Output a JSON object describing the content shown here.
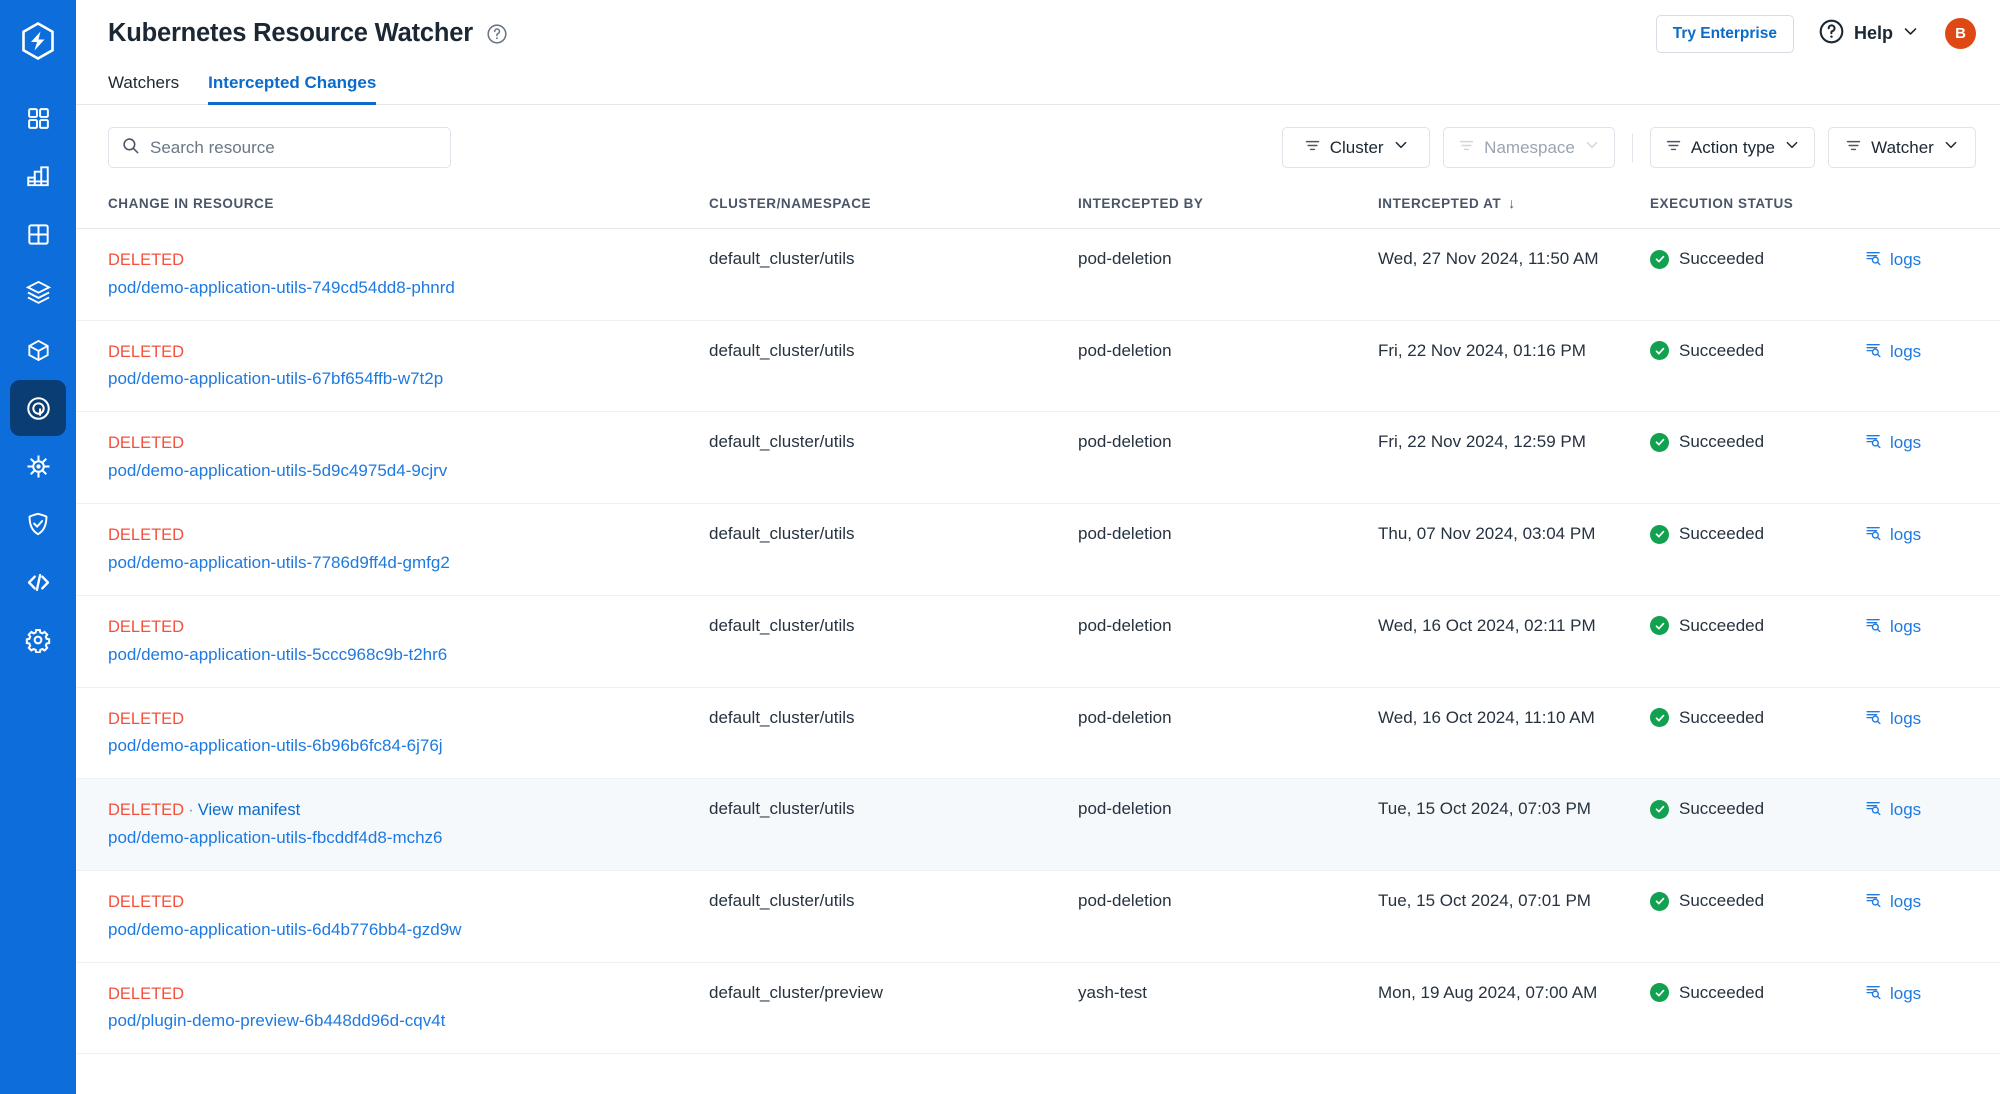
{
  "brand": {
    "accent": "#0d6ddb",
    "sidebar_bg": "#0d6ddb",
    "active_item_bg": "#0a3d73",
    "link": "#1e7ae0",
    "danger": "#f4503c",
    "success": "#12a150",
    "avatar_bg": "#dd4814"
  },
  "header": {
    "title": "Kubernetes Resource Watcher",
    "help_tooltip_icon": "question-circle-icon",
    "try_enterprise_label": "Try Enterprise",
    "help_label": "Help",
    "help_chevron_icon": "chevron-down-icon",
    "avatar_initial": "B"
  },
  "sidebar": {
    "logo_icon": "harness-logo-icon",
    "items": [
      {
        "icon": "dashboard-grid-icon",
        "name": "dashboards",
        "active": false
      },
      {
        "icon": "bar-chart-icon",
        "name": "analytics",
        "active": false
      },
      {
        "icon": "table-grid-icon",
        "name": "projects",
        "active": false
      },
      {
        "icon": "layers-box-icon",
        "name": "deployments",
        "active": false
      },
      {
        "icon": "cube-icon",
        "name": "artifacts",
        "active": false
      },
      {
        "icon": "target-circle-icon",
        "name": "chaos",
        "active": true
      },
      {
        "icon": "helm-wheel-icon",
        "name": "gitops",
        "active": false
      },
      {
        "icon": "shield-check-icon",
        "name": "security",
        "active": false
      },
      {
        "icon": "code-brackets-icon",
        "name": "code",
        "active": false
      },
      {
        "icon": "gear-icon",
        "name": "settings",
        "active": false
      }
    ]
  },
  "tabs": [
    {
      "label": "Watchers",
      "active": false
    },
    {
      "label": "Intercepted Changes",
      "active": true
    }
  ],
  "toolbar": {
    "search": {
      "placeholder": "Search resource",
      "value": "",
      "icon": "search-icon"
    },
    "filters": [
      {
        "label": "Cluster",
        "icon": "filter-lines-icon",
        "chevron": "chevron-down-icon",
        "disabled": false
      },
      {
        "label": "Namespace",
        "icon": "filter-lines-icon",
        "chevron": "chevron-down-icon",
        "disabled": true
      },
      {
        "label": "Action type",
        "icon": "filter-lines-icon",
        "chevron": "chevron-down-icon",
        "disabled": false
      },
      {
        "label": "Watcher",
        "icon": "filter-lines-icon",
        "chevron": "chevron-down-icon",
        "disabled": false
      }
    ]
  },
  "table": {
    "columns": [
      {
        "key": "change",
        "label": "CHANGE IN RESOURCE"
      },
      {
        "key": "cluster",
        "label": "CLUSTER/NAMESPACE"
      },
      {
        "key": "by",
        "label": "INTERCEPTED BY"
      },
      {
        "key": "at",
        "label": "INTERCEPTED AT",
        "sorted": "desc",
        "sort_icon": "arrow-down-icon"
      },
      {
        "key": "status",
        "label": "EXECUTION STATUS"
      },
      {
        "key": "logs",
        "label": ""
      }
    ],
    "logs_label": "logs",
    "logs_icon": "log-search-icon",
    "status_icon": "check-circle-icon",
    "rows": [
      {
        "action": "DELETED",
        "view_manifest": null,
        "resource": "pod/demo-application-utils-749cd54dd8-phnrd",
        "cluster": "default_cluster/utils",
        "by": "pod-deletion",
        "at": "Wed, 27 Nov 2024, 11:50 AM",
        "status": "Succeeded",
        "highlighted": false
      },
      {
        "action": "DELETED",
        "view_manifest": null,
        "resource": "pod/demo-application-utils-67bf654ffb-w7t2p",
        "cluster": "default_cluster/utils",
        "by": "pod-deletion",
        "at": "Fri, 22 Nov 2024, 01:16 PM",
        "status": "Succeeded",
        "highlighted": false
      },
      {
        "action": "DELETED",
        "view_manifest": null,
        "resource": "pod/demo-application-utils-5d9c4975d4-9cjrv",
        "cluster": "default_cluster/utils",
        "by": "pod-deletion",
        "at": "Fri, 22 Nov 2024, 12:59 PM",
        "status": "Succeeded",
        "highlighted": false
      },
      {
        "action": "DELETED",
        "view_manifest": null,
        "resource": "pod/demo-application-utils-7786d9ff4d-gmfg2",
        "cluster": "default_cluster/utils",
        "by": "pod-deletion",
        "at": "Thu, 07 Nov 2024, 03:04 PM",
        "status": "Succeeded",
        "highlighted": false
      },
      {
        "action": "DELETED",
        "view_manifest": null,
        "resource": "pod/demo-application-utils-5ccc968c9b-t2hr6",
        "cluster": "default_cluster/utils",
        "by": "pod-deletion",
        "at": "Wed, 16 Oct 2024, 02:11 PM",
        "status": "Succeeded",
        "highlighted": false
      },
      {
        "action": "DELETED",
        "view_manifest": null,
        "resource": "pod/demo-application-utils-6b96b6fc84-6j76j",
        "cluster": "default_cluster/utils",
        "by": "pod-deletion",
        "at": "Wed, 16 Oct 2024, 11:10 AM",
        "status": "Succeeded",
        "highlighted": false
      },
      {
        "action": "DELETED",
        "view_manifest": "View manifest",
        "resource": "pod/demo-application-utils-fbcddf4d8-mchz6",
        "cluster": "default_cluster/utils",
        "by": "pod-deletion",
        "at": "Tue, 15 Oct 2024, 07:03 PM",
        "status": "Succeeded",
        "highlighted": true
      },
      {
        "action": "DELETED",
        "view_manifest": null,
        "resource": "pod/demo-application-utils-6d4b776bb4-gzd9w",
        "cluster": "default_cluster/utils",
        "by": "pod-deletion",
        "at": "Tue, 15 Oct 2024, 07:01 PM",
        "status": "Succeeded",
        "highlighted": false
      },
      {
        "action": "DELETED",
        "view_manifest": null,
        "resource": "pod/plugin-demo-preview-6b448dd96d-cqv4t",
        "cluster": "default_cluster/preview",
        "by": "yash-test",
        "at": "Mon, 19 Aug 2024, 07:00 AM",
        "status": "Succeeded",
        "highlighted": false
      }
    ]
  }
}
